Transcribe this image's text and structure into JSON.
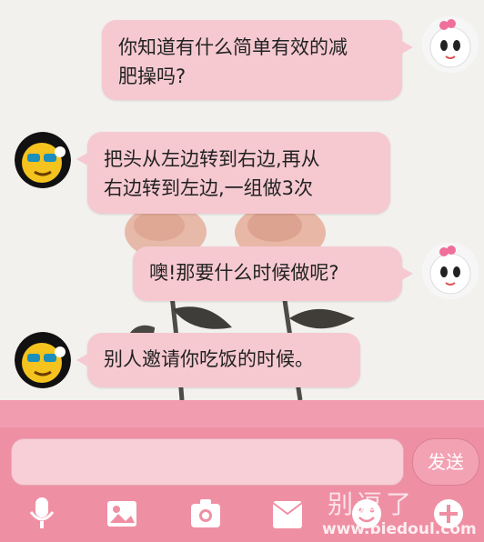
{
  "chat": {
    "messages": [
      {
        "sender": "me",
        "lines": [
          "你知道有什么简单有效的减",
          "肥操吗?"
        ]
      },
      {
        "sender": "other",
        "lines": [
          "把头从左边转到右边,再从",
          "右边转到左边,一组做3次"
        ]
      },
      {
        "sender": "me",
        "lines": [
          "噢!那要什么时候做呢?"
        ]
      },
      {
        "sender": "other",
        "lines": [
          "别人邀请你吃饭的时候。"
        ]
      }
    ]
  },
  "composer": {
    "input_value": "",
    "send_label": "发送"
  },
  "toolbar": {
    "icons": [
      "microphone-icon",
      "image-icon",
      "camera-icon",
      "envelope-icon",
      "emoji-icon",
      "plus-icon"
    ]
  },
  "watermark": {
    "text": "别逗了",
    "url": "www.biedoul.com"
  },
  "colors": {
    "bubble": "#f6c9d1",
    "footer": "#ef8fa4",
    "send_button": "#f3a2b3"
  }
}
